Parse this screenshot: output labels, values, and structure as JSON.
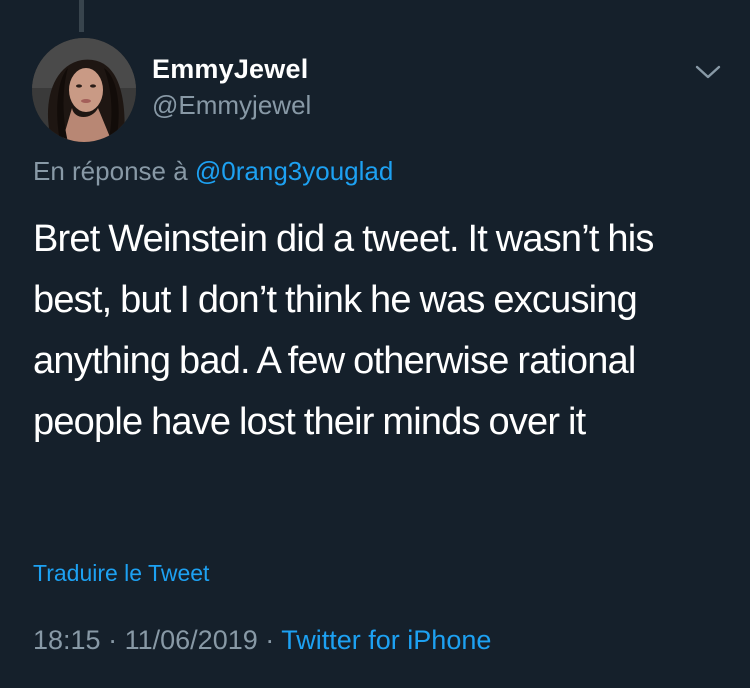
{
  "tweet": {
    "display_name": "EmmyJewel",
    "handle": "@Emmyjewel",
    "reply_prefix": "En réponse à",
    "reply_to": "@0rang3youglad",
    "text": "Bret Weinstein did a tweet. It wasn’t his best, but I don’t think he was excusing anything bad. A few otherwise rational people have lost their minds over it",
    "translate_label": "Traduire le Tweet",
    "time": "18:15",
    "separator": "·",
    "date": "11/06/2019",
    "source": "Twitter for iPhone"
  },
  "icons": {
    "menu": "chevron-down-icon",
    "avatar": "profile-photo"
  },
  "colors": {
    "background": "#15202b",
    "text": "#ffffff",
    "secondary_text": "#8899a6",
    "link": "#1da1f2",
    "thread_line": "#38444d"
  }
}
